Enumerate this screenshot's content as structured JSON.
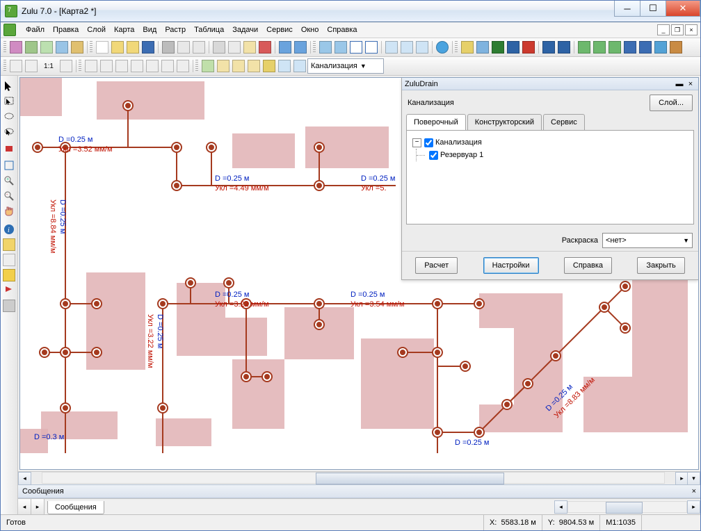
{
  "window": {
    "title": "Zulu 7.0 - [Карта2 *]"
  },
  "menu": [
    "Файл",
    "Правка",
    "Слой",
    "Карта",
    "Вид",
    "Растр",
    "Таблица",
    "Задачи",
    "Сервис",
    "Окно",
    "Справка"
  ],
  "toolbar3_combo": "Канализация",
  "panel": {
    "title": "ZuluDrain",
    "subtitle": "Канализация",
    "layer_btn": "Слой...",
    "tabs": [
      "Поверочный",
      "Конструкторский",
      "Сервис"
    ],
    "tree_root": "Канализация",
    "tree_child": "Резервуар 1",
    "color_label": "Раскраска",
    "color_value": "<нет>",
    "buttons": [
      "Расчет",
      "Настройки",
      "Справка",
      "Закрыть"
    ]
  },
  "labels": {
    "d025": "D =0.25 м",
    "d03": "D =0.3 м",
    "u352": "Укл =3.52 мм/м",
    "u449": "Укл =4.49 мм/м",
    "u5p": "Укл =5.",
    "u884": "Укл =8.84 мм/м",
    "u322": "Укл =3.22 мм/м",
    "u322b": "Укл =3.22 мм/м",
    "u354": "Укл =3.54 мм/м",
    "u883": "Укл =8.83 мм/м",
    "d025b": "D =0.25 м",
    "d025c": "D =0.25 м",
    "d025v1": "D =0.25 м",
    "d025d": "D =0.25 м",
    "d025e": "D =0.25 м",
    "d025f": "D =0.25 м",
    "d025v2": "D =0.25 м",
    "d025g": "D =0.25 м",
    "d025diag": "D =0.25 м"
  },
  "messages_title": "Сообщения",
  "messages_tab": "Сообщения",
  "status": {
    "ready": "Готов",
    "x_label": "X:",
    "x_val": "5583.18 м",
    "y_label": "Y:",
    "y_val": "9804.53 м",
    "scale": "М1:1035"
  }
}
